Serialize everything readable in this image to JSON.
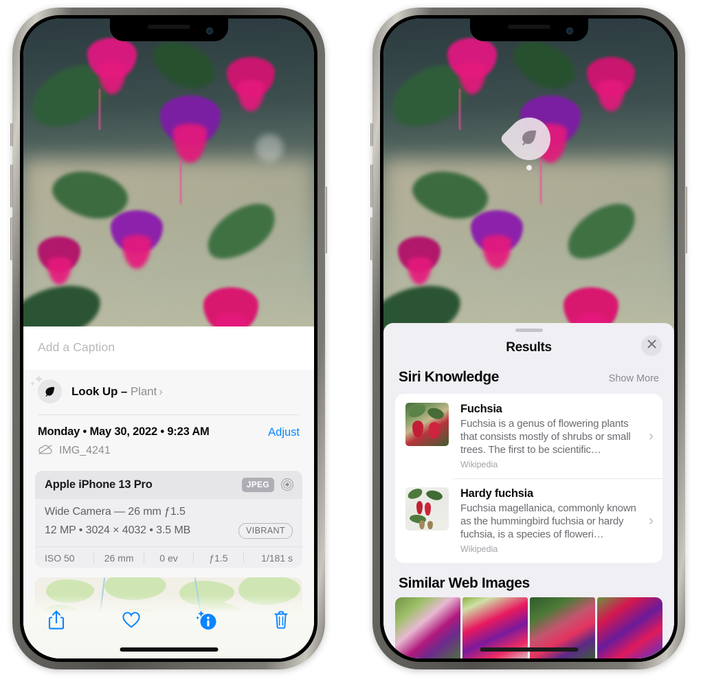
{
  "left_phone": {
    "caption_placeholder": "Add a Caption",
    "lookup": {
      "icon": "leaf-icon",
      "label": "Look Up – ",
      "subject": "Plant",
      "chevron": "›"
    },
    "date": "Monday • May 30, 2022 • 9:23 AM",
    "adjust_label": "Adjust",
    "filename": "IMG_4241",
    "filename_icon": "icloud-slash-icon",
    "camera": {
      "device": "Apple iPhone 13 Pro",
      "format_badge": "JPEG",
      "aperture_icon": "aperture-icon",
      "lens_line": "Wide Camera — 26 mm ƒ1.5",
      "specs_line": "12 MP • 3024 × 4032 • 3.5 MB",
      "style_badge": "VIBRANT",
      "exif": [
        "ISO 50",
        "26 mm",
        "0 ev",
        "ƒ1.5",
        "1/181 s"
      ]
    },
    "map": {
      "name": "photo-location-map"
    },
    "toolbar": [
      {
        "name": "share-button",
        "icon": "share-icon"
      },
      {
        "name": "favorite-button",
        "icon": "heart-icon"
      },
      {
        "name": "info-button",
        "icon": "info-sparkle-icon"
      },
      {
        "name": "delete-button",
        "icon": "trash-icon"
      }
    ]
  },
  "right_phone": {
    "visual_lookup_badge": {
      "icon": "leaf-icon"
    },
    "sheet_title": "Results",
    "close_icon": "close-icon",
    "sections": [
      {
        "title": "Siri Knowledge",
        "action": "Show More",
        "items": [
          {
            "title": "Fuchsia",
            "description": "Fuchsia is a genus of flowering plants that consists mostly of shrubs or small trees. The first to be scientific…",
            "source": "Wikipedia"
          },
          {
            "title": "Hardy fuchsia",
            "description": "Fuchsia magellanica, commonly known as the hummingbird fuchsia or hardy fuchsia, is a species of floweri…",
            "source": "Wikipedia"
          }
        ]
      },
      {
        "title": "Similar Web Images",
        "items": [
          {
            "name": "web-image-1"
          },
          {
            "name": "web-image-2"
          },
          {
            "name": "web-image-3"
          },
          {
            "name": "web-image-4"
          }
        ]
      }
    ]
  },
  "colors": {
    "accent_blue": "#0a84ff",
    "sheet_bg": "#f0eff4",
    "info_bg": "#f7f7f7",
    "card_bg": "#ffffff",
    "secondary_text": "#8e8e93"
  }
}
